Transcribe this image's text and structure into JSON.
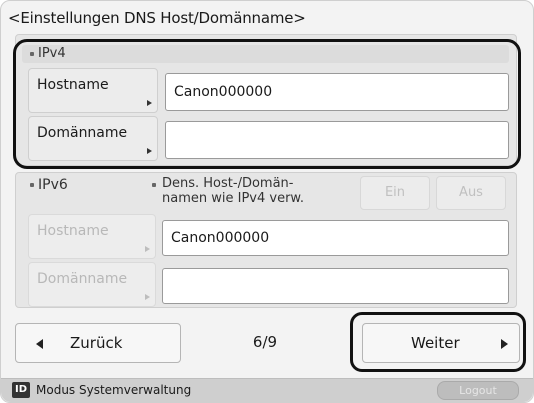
{
  "title": "<Einstellungen DNS Host/Domänname>",
  "ipv4": {
    "label": "IPv4",
    "hostname_label": "Hostname",
    "hostname_value": "Canon000000",
    "domain_label": "Domänname",
    "domain_value": ""
  },
  "ipv6": {
    "label": "IPv6",
    "same_as_ipv4_label": "Dens. Host-/Domän-\nnamen wie IPv4 verw.",
    "on_label": "Ein",
    "off_label": "Aus",
    "hostname_label": "Hostname",
    "hostname_value": "Canon000000",
    "domain_label": "Domänname",
    "domain_value": ""
  },
  "nav": {
    "back_label": "Zurück",
    "page_indicator": "6/9",
    "next_label": "Weiter"
  },
  "status_bar": {
    "icon_letter": "ID",
    "mode_text": "Modus Systemverwaltung",
    "logout_label": "Logout"
  }
}
